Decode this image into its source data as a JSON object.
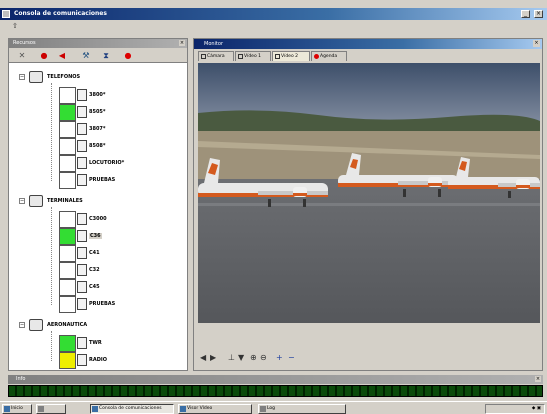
{
  "window": {
    "title": "Consola de comunicaciones"
  },
  "left_panel": {
    "title": "Recursos",
    "toolbar_icons": [
      "close-icon",
      "phone-hangup-icon",
      "speaker-icon",
      "wrench-icon",
      "hourglass-icon",
      "record-icon"
    ],
    "groups": [
      {
        "label": "TELEFONOS",
        "icon": "telephone-icon",
        "items": [
          {
            "label": "3800*",
            "status": ""
          },
          {
            "label": "8505*",
            "status": "#33dd33"
          },
          {
            "label": "3807*",
            "status": ""
          },
          {
            "label": "8508*",
            "status": ""
          },
          {
            "label": "LOCUTORIO*",
            "status": ""
          },
          {
            "label": "PRUEBAS",
            "status": ""
          }
        ]
      },
      {
        "label": "TERMINALES",
        "icon": "radio-terminal-icon",
        "items": [
          {
            "label": "C3000",
            "status": ""
          },
          {
            "label": "C36",
            "status": "#33dd33",
            "selected": true
          },
          {
            "label": "C41",
            "status": ""
          },
          {
            "label": "C32",
            "status": ""
          },
          {
            "label": "C45",
            "status": ""
          },
          {
            "label": "PRUEBAS",
            "status": ""
          }
        ]
      },
      {
        "label": "AERONAUTICA",
        "icon": "aviation-icon",
        "items": [
          {
            "label": "TWR",
            "status": "#33dd33"
          },
          {
            "label": "RADIO",
            "status": "#eeee00"
          }
        ]
      }
    ]
  },
  "right_panel": {
    "title": "Monitor",
    "tabs": [
      {
        "label": "Cámara",
        "active": false
      },
      {
        "label": "Vídeo 1",
        "active": false
      },
      {
        "label": "Vídeo 2",
        "active": true
      },
      {
        "label": "Agenda",
        "active": false
      }
    ],
    "video_toolbar_icons": [
      "rewind-icon",
      "play-icon",
      "antenna-icon",
      "filter-icon",
      "zoom-in-icon",
      "zoom-out-icon",
      "add-icon",
      "remove-icon"
    ]
  },
  "status_panel": {
    "title": "Info"
  },
  "taskbar": {
    "start_label": "Inicio",
    "buttons": [
      {
        "label": "Consola de comunicaciones",
        "pressed": true
      },
      {
        "label": "Visor Vídeo",
        "pressed": false
      },
      {
        "label": "Log",
        "pressed": false
      }
    ]
  },
  "colors": {
    "title_bar": "#0a246a",
    "status_green": "#33dd33",
    "status_yellow": "#eeee00",
    "led_bar": "#003300"
  }
}
